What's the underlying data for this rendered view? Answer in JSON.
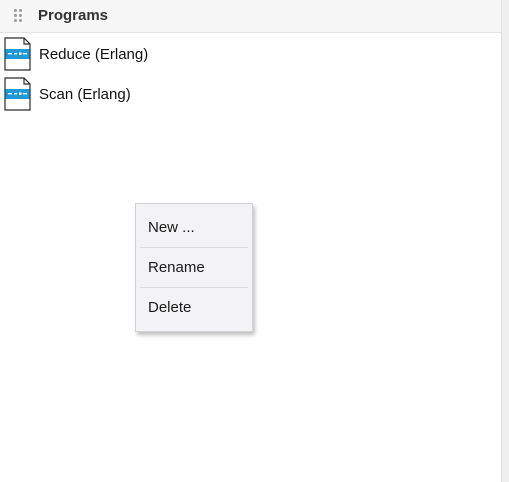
{
  "panel": {
    "title": "Programs",
    "items": [
      {
        "label": "Reduce (Erlang)",
        "icon": "erlang-program-file-icon"
      },
      {
        "label": "Scan (Erlang)",
        "icon": "erlang-program-file-icon"
      }
    ]
  },
  "context_menu": {
    "items": [
      {
        "label": "New ..."
      },
      {
        "label": "Rename"
      },
      {
        "label": "Delete"
      }
    ]
  },
  "colors": {
    "icon_accent": "#1e9ad6",
    "menu_background": "#f3f3f5"
  }
}
